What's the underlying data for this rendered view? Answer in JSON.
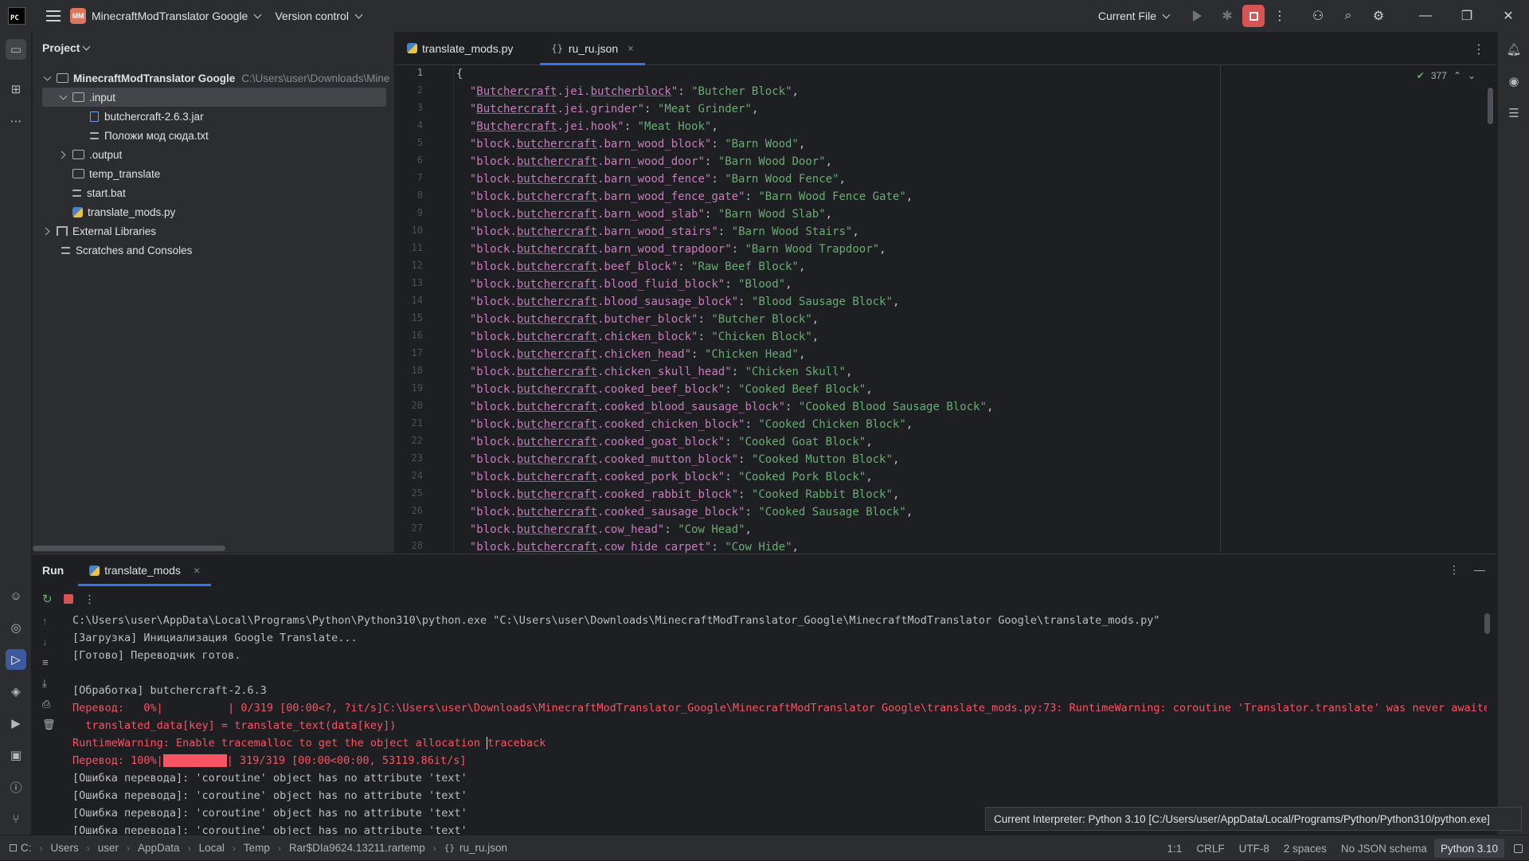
{
  "titlebar": {
    "logo": "PC",
    "project_badge": "MM",
    "project_name": "MinecraftModTranslator Google",
    "vcs": "Version control",
    "run_config": "Current File"
  },
  "project_panel": {
    "title": "Project",
    "root": "MinecraftModTranslator Google",
    "root_path": "C:\\Users\\user\\Downloads\\Mine",
    "input_folder": ".input",
    "jar": "butchercraft-2.6.3.jar",
    "txt": "Положи мод сюда.txt",
    "output_folder": ".output",
    "temp": "temp_translate",
    "bat": "start.bat",
    "py": "translate_mods.py",
    "libraries": "External Libraries",
    "scratches": "Scratches and Consoles"
  },
  "editor": {
    "tabs": [
      {
        "label": "translate_mods.py",
        "icon": "python-file-icon"
      },
      {
        "label": "ru_ru.json",
        "icon": "json-file-icon"
      }
    ],
    "inspection_count": "377",
    "line_numbers": [
      "1",
      "2",
      "3",
      "4",
      "5",
      "6",
      "7",
      "8",
      "9",
      "10",
      "11",
      "12",
      "13",
      "14",
      "15",
      "16",
      "17",
      "18",
      "19",
      "20",
      "21",
      "22",
      "23",
      "24",
      "25",
      "26",
      "27",
      "28"
    ],
    "first_line": "{",
    "lines": [
      {
        "prefix": "",
        "key": "Butchercraft",
        "rest": ".jei.",
        "key2": "butcherblock",
        "value": "Butcher Block"
      },
      {
        "prefix": "",
        "key": "Butchercraft",
        "rest": ".jei.grinder",
        "key2": "",
        "value": "Meat Grinder"
      },
      {
        "prefix": "",
        "key": "Butchercraft",
        "rest": ".jei.hook",
        "key2": "",
        "value": "Meat Hook"
      },
      {
        "prefix": "block.",
        "key": "butchercraft",
        "rest": ".barn_wood_block",
        "key2": "",
        "value": "Barn Wood"
      },
      {
        "prefix": "block.",
        "key": "butchercraft",
        "rest": ".barn_wood_door",
        "key2": "",
        "value": "Barn Wood Door"
      },
      {
        "prefix": "block.",
        "key": "butchercraft",
        "rest": ".barn_wood_fence",
        "key2": "",
        "value": "Barn Wood Fence"
      },
      {
        "prefix": "block.",
        "key": "butchercraft",
        "rest": ".barn_wood_fence_gate",
        "key2": "",
        "value": "Barn Wood Fence Gate"
      },
      {
        "prefix": "block.",
        "key": "butchercraft",
        "rest": ".barn_wood_slab",
        "key2": "",
        "value": "Barn Wood Slab"
      },
      {
        "prefix": "block.",
        "key": "butchercraft",
        "rest": ".barn_wood_stairs",
        "key2": "",
        "value": "Barn Wood Stairs"
      },
      {
        "prefix": "block.",
        "key": "butchercraft",
        "rest": ".barn_wood_trapdoor",
        "key2": "",
        "value": "Barn Wood Trapdoor"
      },
      {
        "prefix": "block.",
        "key": "butchercraft",
        "rest": ".beef_block",
        "key2": "",
        "value": "Raw Beef Block"
      },
      {
        "prefix": "block.",
        "key": "butchercraft",
        "rest": ".blood_fluid_block",
        "key2": "",
        "value": "Blood"
      },
      {
        "prefix": "block.",
        "key": "butchercraft",
        "rest": ".blood_sausage_block",
        "key2": "",
        "value": "Blood Sausage Block"
      },
      {
        "prefix": "block.",
        "key": "butchercraft",
        "rest": ".butcher_block",
        "key2": "",
        "value": "Butcher Block"
      },
      {
        "prefix": "block.",
        "key": "butchercraft",
        "rest": ".chicken_block",
        "key2": "",
        "value": "Chicken Block"
      },
      {
        "prefix": "block.",
        "key": "butchercraft",
        "rest": ".chicken_head",
        "key2": "",
        "value": "Chicken Head"
      },
      {
        "prefix": "block.",
        "key": "butchercraft",
        "rest": ".chicken_skull_head",
        "key2": "",
        "value": "Chicken Skull"
      },
      {
        "prefix": "block.",
        "key": "butchercraft",
        "rest": ".cooked_beef_block",
        "key2": "",
        "value": "Cooked Beef Block"
      },
      {
        "prefix": "block.",
        "key": "butchercraft",
        "rest": ".cooked_blood_sausage_block",
        "key2": "",
        "value": "Cooked Blood Sausage Block"
      },
      {
        "prefix": "block.",
        "key": "butchercraft",
        "rest": ".cooked_chicken_block",
        "key2": "",
        "value": "Cooked Chicken Block"
      },
      {
        "prefix": "block.",
        "key": "butchercraft",
        "rest": ".cooked_goat_block",
        "key2": "",
        "value": "Cooked Goat Block"
      },
      {
        "prefix": "block.",
        "key": "butchercraft",
        "rest": ".cooked_mutton_block",
        "key2": "",
        "value": "Cooked Mutton Block"
      },
      {
        "prefix": "block.",
        "key": "butchercraft",
        "rest": ".cooked_pork_block",
        "key2": "",
        "value": "Cooked Pork Block"
      },
      {
        "prefix": "block.",
        "key": "butchercraft",
        "rest": ".cooked_rabbit_block",
        "key2": "",
        "value": "Cooked Rabbit Block"
      },
      {
        "prefix": "block.",
        "key": "butchercraft",
        "rest": ".cooked_sausage_block",
        "key2": "",
        "value": "Cooked Sausage Block"
      },
      {
        "prefix": "block.",
        "key": "butchercraft",
        "rest": ".cow_head",
        "key2": "",
        "value": "Cow Head"
      },
      {
        "prefix": "block.",
        "key": "butchercraft",
        "rest": ".cow_hide_carpet",
        "key2": "",
        "value": "Cow Hide"
      }
    ]
  },
  "run_panel": {
    "title": "Run",
    "tab": "translate_mods",
    "console": [
      {
        "text": "C:\\Users\\user\\AppData\\Local\\Programs\\Python\\Python310\\python.exe \"C:\\Users\\user\\Downloads\\MinecraftModTranslator_Google\\MinecraftModTranslator Google\\translate_mods.py\"",
        "err": false
      },
      {
        "text": "[Загрузка] Инициализация Google Translate...",
        "err": false
      },
      {
        "text": "[Готово] Переводчик готов.",
        "err": false
      },
      {
        "text": "",
        "err": false
      },
      {
        "text": "[Обработка] butchercraft-2.6.3",
        "err": false
      },
      {
        "text": "Перевод:   0%|          | 0/319 [00:00<?, ?it/s]C:\\Users\\user\\Downloads\\MinecraftModTranslator_Google\\MinecraftModTranslator Google\\translate_mods.py:73: RuntimeWarning: coroutine 'Translator.translate' was never awaited",
        "err": true
      },
      {
        "text": "  translated_data[key] = translate_text(data[key])",
        "err": true
      },
      {
        "text": "RuntimeWarning: Enable tracemalloc to get the object allocation traceback",
        "err": true
      },
      {
        "text": "",
        "err": true
      },
      {
        "text": "[Ошибка перевода]: 'coroutine' object has no attribute 'text'",
        "err": false
      },
      {
        "text": "[Ошибка перевода]: 'coroutine' object has no attribute 'text'",
        "err": false
      },
      {
        "text": "[Ошибка перевода]: 'coroutine' object has no attribute 'text'",
        "err": false
      },
      {
        "text": "[Ошибка перевода]: 'coroutine' object has no attribute 'text'",
        "err": false
      }
    ],
    "progress_prefix": "Перевод: 100%|",
    "progress_suffix": "| 319/319 [00:00<00:00, 53119.86it/s]",
    "progress_fraction": 1.0,
    "warn_a": "RuntimeWarning: Enable tracemalloc to get the object allocation ",
    "warn_b": "traceback"
  },
  "tooltip": "Current Interpreter: Python 3.10 [C:/Users/user/AppData/Local/Programs/Python/Python310/python.exe]",
  "statusbar": {
    "breadcrumbs": [
      "C:",
      "Users",
      "user",
      "AppData",
      "Local",
      "Temp",
      "Rar$DIa9624.13211.rartemp",
      "ru_ru.json"
    ],
    "position": "1:1",
    "line_sep": "CRLF",
    "encoding": "UTF-8",
    "indent": "2 spaces",
    "schema": "No JSON schema",
    "interpreter": "Python 3.10"
  }
}
